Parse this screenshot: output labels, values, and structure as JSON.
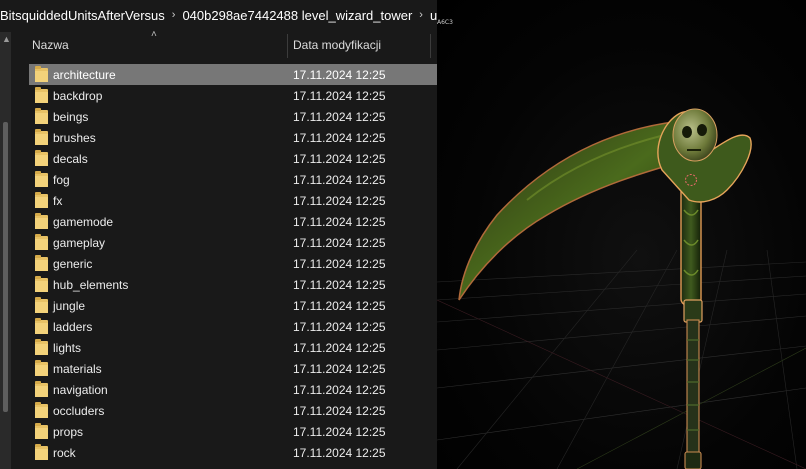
{
  "breadcrumb": [
    {
      "label": "BitsquiddedUnitsAfterVersus"
    },
    {
      "label": "040b298ae7442488 level_wizard_tower"
    },
    {
      "label": "units"
    }
  ],
  "header": {
    "name_col": "Nazwa",
    "date_col": "Data modyfikacji"
  },
  "files": [
    {
      "name": "architecture",
      "date": "17.11.2024 12:25",
      "selected": true
    },
    {
      "name": "backdrop",
      "date": "17.11.2024 12:25"
    },
    {
      "name": "beings",
      "date": "17.11.2024 12:25"
    },
    {
      "name": "brushes",
      "date": "17.11.2024 12:25"
    },
    {
      "name": "decals",
      "date": "17.11.2024 12:25"
    },
    {
      "name": "fog",
      "date": "17.11.2024 12:25"
    },
    {
      "name": "fx",
      "date": "17.11.2024 12:25"
    },
    {
      "name": "gamemode",
      "date": "17.11.2024 12:25"
    },
    {
      "name": "gameplay",
      "date": "17.11.2024 12:25"
    },
    {
      "name": "generic",
      "date": "17.11.2024 12:25"
    },
    {
      "name": "hub_elements",
      "date": "17.11.2024 12:25"
    },
    {
      "name": "jungle",
      "date": "17.11.2024 12:25"
    },
    {
      "name": "ladders",
      "date": "17.11.2024 12:25"
    },
    {
      "name": "lights",
      "date": "17.11.2024 12:25"
    },
    {
      "name": "materials",
      "date": "17.11.2024 12:25"
    },
    {
      "name": "navigation",
      "date": "17.11.2024 12:25"
    },
    {
      "name": "occluders",
      "date": "17.11.2024 12:25"
    },
    {
      "name": "props",
      "date": "17.11.2024 12:25"
    },
    {
      "name": "rock",
      "date": "17.11.2024 12:25"
    }
  ],
  "viewport": {
    "label": "A6C3",
    "model": "scythe-with-skull"
  },
  "colors": {
    "explorer_bg": "#191919",
    "selected_row": "#777777",
    "folder": "#f3d27a",
    "scythe_glow": "#e0a060",
    "blade_green": "#4a6a1c"
  }
}
